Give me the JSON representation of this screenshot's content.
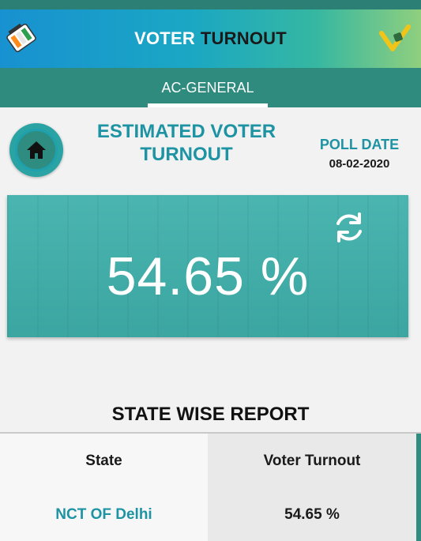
{
  "header": {
    "title_part1": "VOTER",
    "title_part2": "TURNOUT",
    "left_logo_icon": "ballot-box-logo-icon",
    "right_logo_icon": "voter-check-logo-icon"
  },
  "tabs": [
    {
      "label": "AC-GENERAL",
      "active": true
    }
  ],
  "summary": {
    "title": "ESTIMATED VOTER TURNOUT",
    "poll_date_label": "POLL DATE",
    "poll_date": "08-02-2020",
    "home_icon": "home-icon"
  },
  "turnout_card": {
    "value": "54.65 %",
    "refresh_icon": "refresh-icon"
  },
  "report": {
    "title": "STATE WISE REPORT",
    "columns": [
      "State",
      "Voter Turnout"
    ],
    "rows": [
      {
        "state": "NCT OF Delhi",
        "turnout": "54.65 %"
      }
    ]
  },
  "colors": {
    "accent": "#1d93a3",
    "tabbar": "#2e8b7e",
    "card": "#3fb0ab"
  }
}
